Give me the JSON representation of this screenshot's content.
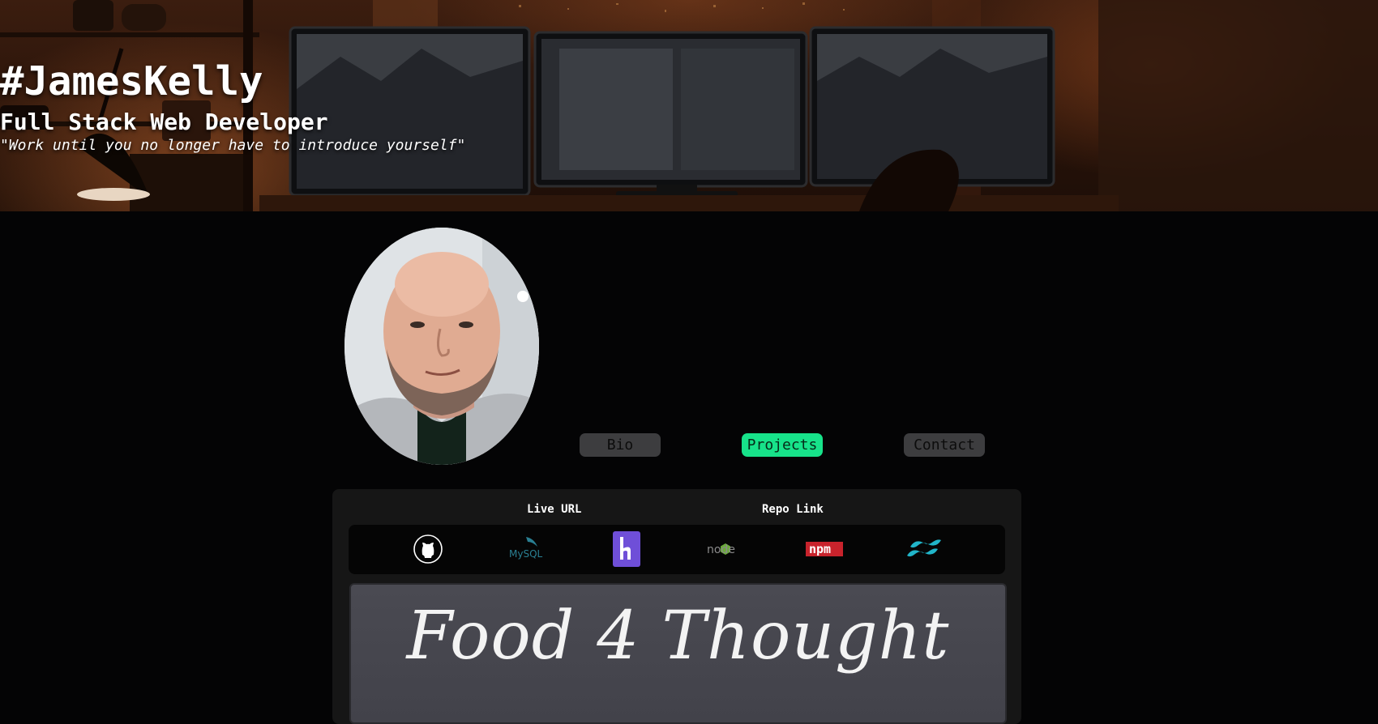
{
  "hero": {
    "title": "#JamesKelly",
    "subtitle": "Full Stack Web Developer",
    "quote": "\"Work until you no longer have to introduce yourself\""
  },
  "profile": {
    "photo_icon": "person-portrait"
  },
  "nav": {
    "bio": "Bio",
    "projects": "Projects",
    "contact": "Contact",
    "active": "projects",
    "active_color": "#17e38a",
    "inactive_color": "#3d3d3f"
  },
  "project": {
    "live_url_label": "Live URL",
    "repo_link_label": "Repo Link",
    "tech_icons": [
      "github-icon",
      "mysql-icon",
      "heroku-icon",
      "node-icon",
      "npm-icon",
      "tailwind-icon"
    ],
    "tech_labels": {
      "mysql": "MySQL",
      "node": "node",
      "npm": "npm"
    },
    "preview_title": "Food 4 Thought"
  }
}
